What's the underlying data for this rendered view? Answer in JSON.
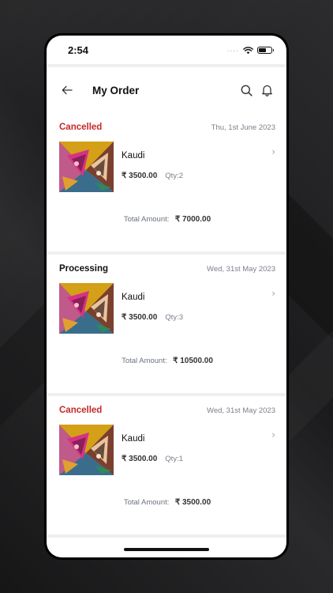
{
  "status_bar": {
    "time": "2:54",
    "dots": "...."
  },
  "header": {
    "title": "My Order"
  },
  "colors": {
    "cancelled": "#c62828",
    "processing": "#111111",
    "divider": "#efefef"
  },
  "icons": {
    "back": "arrow-left-icon",
    "search": "search-icon",
    "notifications": "bell-icon",
    "chevron": "chevron-right-icon"
  },
  "orders": [
    {
      "status": "Cancelled",
      "date": "Thu, 1st June 2023",
      "item_name": "Kaudi",
      "price": "₹ 3500.00",
      "qty": "Qty:2",
      "total_label": "Total Amount:",
      "total_value": "₹ 7000.00"
    },
    {
      "status": "Processing",
      "date": "Wed, 31st May 2023",
      "item_name": "Kaudi",
      "price": "₹ 3500.00",
      "qty": "Qty:3",
      "total_label": "Total Amount:",
      "total_value": "₹ 10500.00"
    },
    {
      "status": "Cancelled",
      "date": "Wed, 31st May 2023",
      "item_name": "Kaudi",
      "price": "₹ 3500.00",
      "qty": "Qty:1",
      "total_label": "Total Amount:",
      "total_value": "₹ 3500.00"
    }
  ]
}
